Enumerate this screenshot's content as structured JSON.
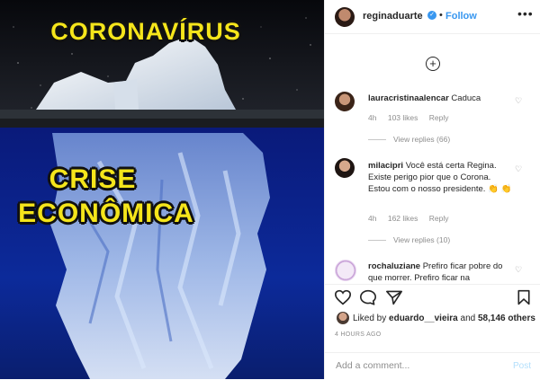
{
  "media": {
    "top_text": "CORONAVÍRUS",
    "bottom_text_line1": "CRISE",
    "bottom_text_line2": "ECONÔMICA"
  },
  "header": {
    "username": "reginaduarte",
    "verified_mark": "✓",
    "separator": "•",
    "follow_label": "Follow",
    "more_label": "•••"
  },
  "comments": {
    "load_more_label": "+",
    "items": [
      {
        "username": "lauracristinaalencar",
        "text": "Caduca",
        "time": "4h",
        "likes": "103 likes",
        "reply": "Reply",
        "view_replies": "View replies (66)"
      },
      {
        "username": "milacipri",
        "text": "Você está certa Regina. Existe perigo pior que o Corona. Estou com o nosso presidente. 👏 👏",
        "time": "4h",
        "likes": "162 likes",
        "reply": "Reply",
        "view_replies": "View replies (10)"
      },
      {
        "username": "rochaluziane",
        "text": "Prefiro ficar pobre do que morrer. Prefiro ficar na"
      }
    ]
  },
  "actions": {
    "liked_prefix": "Liked by ",
    "liked_user": "eduardo__vieira",
    "liked_and": " and ",
    "liked_count": "58,146 others",
    "time": "4 HOURS AGO",
    "add_comment_placeholder": "Add a comment...",
    "post_label": "Post"
  },
  "colors": {
    "accent": "#3897f0",
    "meme_text": "#f5e51b",
    "sky": "#0d0f14",
    "ocean": "#0b1f8c"
  }
}
